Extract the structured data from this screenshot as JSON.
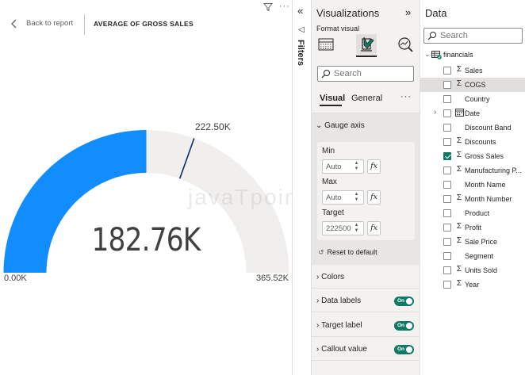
{
  "report": {
    "back_label": "Back to report",
    "visual_title": "AVERAGE OF GROSS SALES",
    "filter_icon": "filter-icon",
    "more_icon": "more-options-icon",
    "watermark": "javaTpoint"
  },
  "gauge": {
    "value_label": "182.76K",
    "min_label": "0.00K",
    "max_label": "365.52K",
    "target_label": "222.50K",
    "value": 182760,
    "min": 0,
    "max": 365520,
    "target": 222500,
    "fill_color": "#118DFF",
    "track_color": "#F0EFEE",
    "target_color": "#0F2A6B"
  },
  "filters": {
    "label": "Filters",
    "collapse_glyph": "«",
    "icon_glyph": "◁"
  },
  "visualizations": {
    "title": "Visualizations",
    "collapse_glyph": "»",
    "format_visual_label": "Format visual",
    "search_placeholder": "Search",
    "tabs": {
      "visual": "Visual",
      "general": "General",
      "more": "···"
    },
    "gauge_axis": {
      "header": "Gauge axis",
      "min_label": "Min",
      "min_value": "Auto",
      "max_label": "Max",
      "max_value": "Auto",
      "target_label": "Target",
      "target_value": "222500",
      "fx": "fx",
      "reset": "Reset to default"
    },
    "sections": [
      {
        "label": "Colors",
        "toggle": null
      },
      {
        "label": "Data labels",
        "toggle": "On"
      },
      {
        "label": "Target label",
        "toggle": "On"
      },
      {
        "label": "Callout value",
        "toggle": "On"
      }
    ]
  },
  "data": {
    "title": "Data",
    "search_placeholder": "Search",
    "table_name": "financials",
    "fields": [
      {
        "name": "Sales",
        "type": "Σ",
        "checked": false,
        "highlight": false,
        "expandable": false
      },
      {
        "name": "COGS",
        "type": "Σ",
        "checked": false,
        "highlight": true,
        "expandable": false
      },
      {
        "name": "Country",
        "type": "",
        "checked": false,
        "highlight": false,
        "expandable": false
      },
      {
        "name": "Date",
        "type": "calendar",
        "checked": false,
        "highlight": false,
        "expandable": true
      },
      {
        "name": "Discount Band",
        "type": "",
        "checked": false,
        "highlight": false,
        "expandable": false
      },
      {
        "name": "Discounts",
        "type": "Σ",
        "checked": false,
        "highlight": false,
        "expandable": false
      },
      {
        "name": "Gross Sales",
        "type": "Σ",
        "checked": true,
        "highlight": false,
        "expandable": false
      },
      {
        "name": "Manufacturing P...",
        "type": "Σ",
        "checked": false,
        "highlight": false,
        "expandable": false
      },
      {
        "name": "Month Name",
        "type": "",
        "checked": false,
        "highlight": false,
        "expandable": false
      },
      {
        "name": "Month Number",
        "type": "Σ",
        "checked": false,
        "highlight": false,
        "expandable": false
      },
      {
        "name": "Product",
        "type": "",
        "checked": false,
        "highlight": false,
        "expandable": false
      },
      {
        "name": "Profit",
        "type": "Σ",
        "checked": false,
        "highlight": false,
        "expandable": false
      },
      {
        "name": "Sale Price",
        "type": "Σ",
        "checked": false,
        "highlight": false,
        "expandable": false
      },
      {
        "name": "Segment",
        "type": "",
        "checked": false,
        "highlight": false,
        "expandable": false
      },
      {
        "name": "Units Sold",
        "type": "Σ",
        "checked": false,
        "highlight": false,
        "expandable": false
      },
      {
        "name": "Year",
        "type": "Σ",
        "checked": false,
        "highlight": false,
        "expandable": false
      }
    ]
  }
}
